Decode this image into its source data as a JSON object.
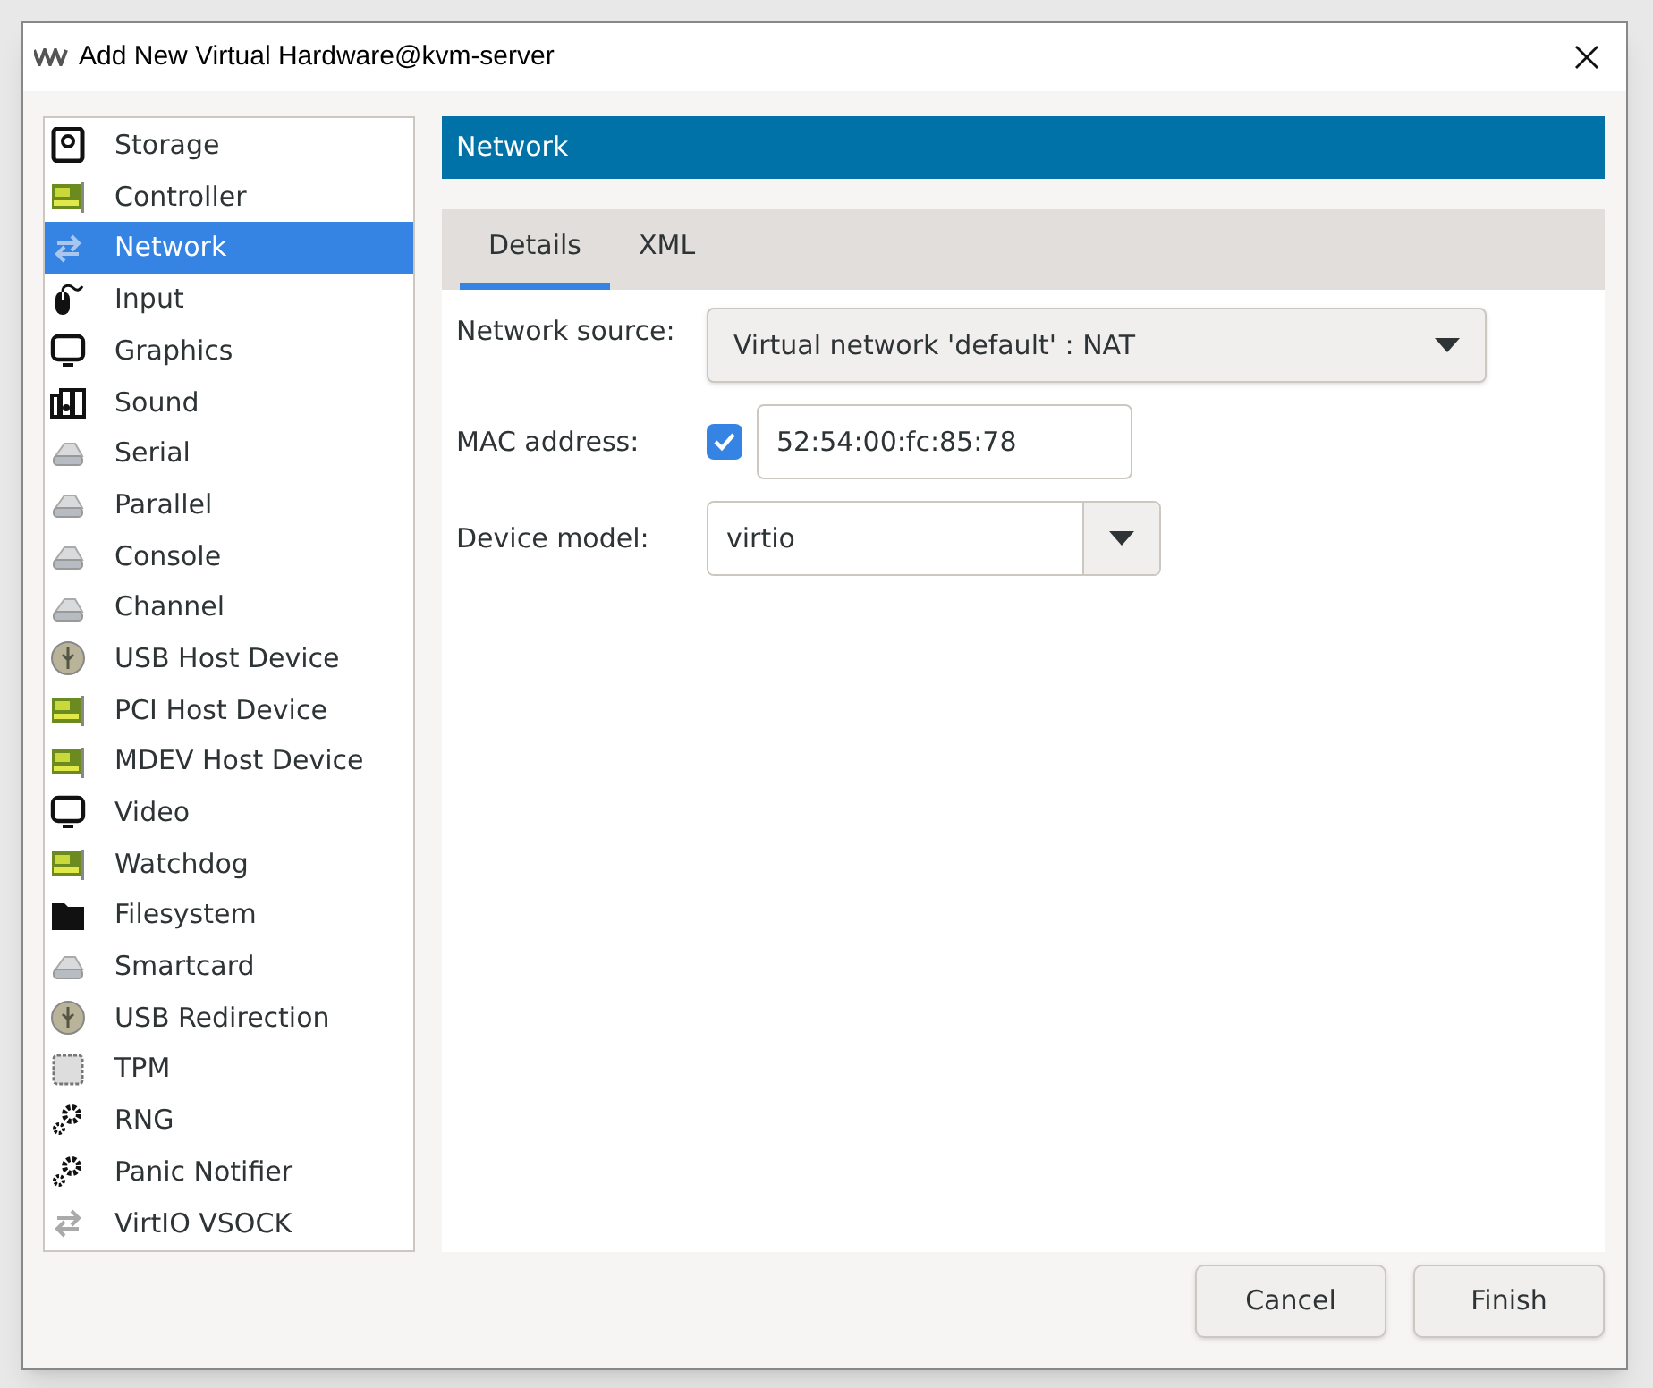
{
  "window": {
    "title": "Add New Virtual Hardware@kvm-server"
  },
  "sidebar": {
    "items": [
      {
        "label": "Storage",
        "kind": "disk",
        "selected": false
      },
      {
        "label": "Controller",
        "kind": "card",
        "selected": false
      },
      {
        "label": "Network",
        "kind": "arrows",
        "selected": true
      },
      {
        "label": "Input",
        "kind": "mouse",
        "selected": false
      },
      {
        "label": "Graphics",
        "kind": "monitor",
        "selected": false
      },
      {
        "label": "Sound",
        "kind": "sound",
        "selected": false
      },
      {
        "label": "Serial",
        "kind": "port",
        "selected": false
      },
      {
        "label": "Parallel",
        "kind": "port",
        "selected": false
      },
      {
        "label": "Console",
        "kind": "port",
        "selected": false
      },
      {
        "label": "Channel",
        "kind": "port",
        "selected": false
      },
      {
        "label": "USB Host Device",
        "kind": "usb",
        "selected": false
      },
      {
        "label": "PCI Host Device",
        "kind": "card",
        "selected": false
      },
      {
        "label": "MDEV Host Device",
        "kind": "card",
        "selected": false
      },
      {
        "label": "Video",
        "kind": "monitor",
        "selected": false
      },
      {
        "label": "Watchdog",
        "kind": "card",
        "selected": false
      },
      {
        "label": "Filesystem",
        "kind": "folder",
        "selected": false
      },
      {
        "label": "Smartcard",
        "kind": "port",
        "selected": false
      },
      {
        "label": "USB Redirection",
        "kind": "usb",
        "selected": false
      },
      {
        "label": "TPM",
        "kind": "chip",
        "selected": false
      },
      {
        "label": "RNG",
        "kind": "gears",
        "selected": false
      },
      {
        "label": "Panic Notifier",
        "kind": "gears",
        "selected": false
      },
      {
        "label": "VirtIO VSOCK",
        "kind": "arrows",
        "selected": false
      }
    ]
  },
  "panel": {
    "title": "Network",
    "tabs": [
      {
        "label": "Details",
        "selected": true
      },
      {
        "label": "XML",
        "selected": false
      }
    ],
    "fields": [
      {
        "kind": "dropdown",
        "label": "Network source:",
        "value": "Virtual network 'default' : NAT"
      },
      {
        "kind": "checked-entry",
        "label": "MAC address:",
        "checked": true,
        "value": "52:54:00:fc:85:78"
      },
      {
        "kind": "combo",
        "label": "Device model:",
        "value": "virtio"
      }
    ]
  },
  "buttons": [
    {
      "label": "Cancel"
    },
    {
      "label": "Finish"
    }
  ]
}
